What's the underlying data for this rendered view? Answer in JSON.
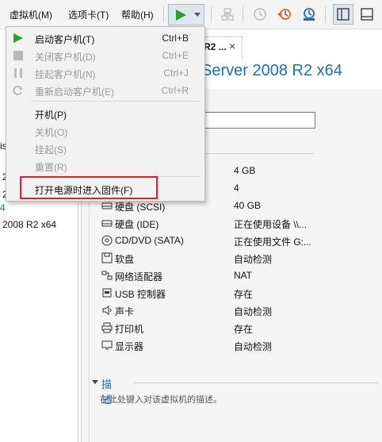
{
  "menubar": {
    "vm_menu": "虚拟机(M)",
    "tabs_menu": "选项卡(T)",
    "help_menu": "帮助(H)"
  },
  "library": {
    "fragments": [
      "is",
      "2",
      "2",
      "4",
      "2008 R2 x64"
    ]
  },
  "tab": {
    "label_fragment": "R2 ...",
    "close": "×"
  },
  "vm": {
    "title_fragment": "Server 2008 R2 x64"
  },
  "devices": [
    {
      "name": "",
      "value": "4 GB",
      "icon": "memory-icon"
    },
    {
      "name": "",
      "value": "4",
      "icon": "processor-icon"
    },
    {
      "name": "硬盘 (SCSI)",
      "value": "40 GB",
      "icon": "hard-disk-icon"
    },
    {
      "name": "硬盘 (IDE)",
      "value": "正在使用设备 \\\\...",
      "icon": "hard-disk-icon"
    },
    {
      "name": "CD/DVD (SATA)",
      "value": "正在使用文件 G:...",
      "icon": "cd-dvd-icon"
    },
    {
      "name": "软盘",
      "value": "自动检测",
      "icon": "floppy-icon"
    },
    {
      "name": "网络适配器",
      "value": "NAT",
      "icon": "network-adapter-icon"
    },
    {
      "name": "USB 控制器",
      "value": "存在",
      "icon": "usb-icon"
    },
    {
      "name": "声卡",
      "value": "自动检测",
      "icon": "sound-card-icon"
    },
    {
      "name": "打印机",
      "value": "存在",
      "icon": "printer-icon"
    },
    {
      "name": "显示器",
      "value": "自动检测",
      "icon": "display-icon"
    }
  ],
  "description": {
    "title": "描述",
    "placeholder": "在此处键入对该虚拟机的描述。"
  },
  "power_menu": {
    "items": [
      {
        "label": "启动客户机(T)",
        "shortcut": "Ctrl+B",
        "enabled": true,
        "icon": "play-icon"
      },
      {
        "label": "关闭客户机(D)",
        "shortcut": "Ctrl+E",
        "enabled": false,
        "icon": "stop-icon"
      },
      {
        "label": "挂起客户机(N)",
        "shortcut": "Ctrl+J",
        "enabled": false,
        "icon": "pause-icon"
      },
      {
        "label": "重新启动客户机(E)",
        "shortcut": "Ctrl+R",
        "enabled": false,
        "icon": "restart-icon"
      },
      {
        "label": "开机(P)",
        "shortcut": "",
        "enabled": true,
        "icon": ""
      },
      {
        "label": "关机(O)",
        "shortcut": "",
        "enabled": false,
        "icon": ""
      },
      {
        "label": "挂起(S)",
        "shortcut": "",
        "enabled": false,
        "icon": ""
      },
      {
        "label": "重置(R)",
        "shortcut": "",
        "enabled": false,
        "icon": ""
      },
      {
        "label": "打开电源时进入固件(F)",
        "shortcut": "",
        "enabled": true,
        "icon": ""
      }
    ]
  },
  "colors": {
    "accent_blue": "#1d6fb8",
    "play_green": "#2e9e2e",
    "highlight_red": "#e0202a",
    "snapshot_orange": "#e8641e"
  }
}
